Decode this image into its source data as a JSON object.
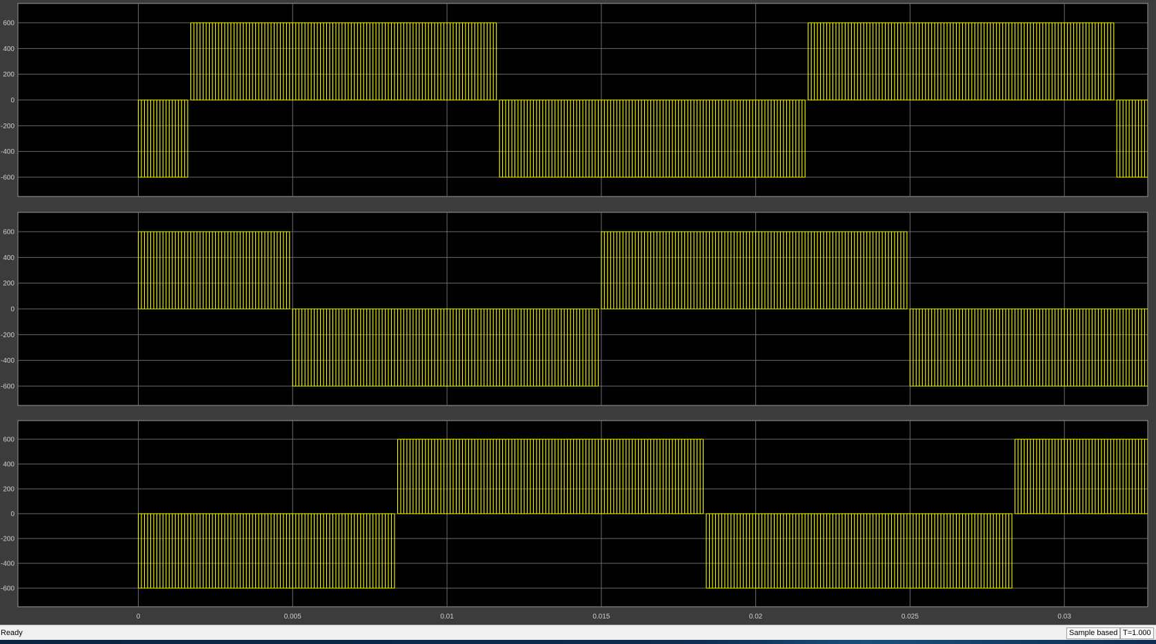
{
  "status_bar": {
    "status": "Ready",
    "sample_mode": "Sample based",
    "time": "T=1.000"
  },
  "colors": {
    "axes_background": "#000000",
    "figure_background": "#3c3c3c",
    "trace": "#ffff00",
    "grid": "#6e6e6e",
    "tick_text": "#cfcfcf"
  },
  "chart_data": [
    {
      "type": "line",
      "title": "",
      "xlabel": "",
      "ylabel": "",
      "xlim": [
        -0.0039,
        0.0327
      ],
      "ylim": [
        -750,
        750
      ],
      "yticks": [
        600,
        400,
        200,
        0,
        -200,
        -400,
        -600
      ],
      "ytick_labels": [
        "600",
        "400",
        "200",
        "0",
        "-200",
        "-400",
        "-600"
      ],
      "xticks": [
        0,
        0.005,
        0.01,
        0.015,
        0.02,
        0.025,
        0.03
      ],
      "xtick_labels": [],
      "grid": true,
      "pwm_period": 0.0001,
      "series": [
        {
          "segments": [
            {
              "x_start": 0.0,
              "x_end": 0.0016,
              "level": -600
            },
            {
              "x_start": 0.0017,
              "x_end": 0.0116,
              "level": 600
            },
            {
              "x_start": 0.0117,
              "x_end": 0.0216,
              "level": -600
            },
            {
              "x_start": 0.0217,
              "x_end": 0.0316,
              "level": 600
            },
            {
              "x_start": 0.0317,
              "x_end": 0.0327,
              "level": -600
            }
          ]
        }
      ]
    },
    {
      "type": "line",
      "title": "",
      "xlabel": "",
      "ylabel": "",
      "xlim": [
        -0.0039,
        0.0327
      ],
      "ylim": [
        -750,
        750
      ],
      "yticks": [
        600,
        400,
        200,
        0,
        -200,
        -400,
        -600
      ],
      "ytick_labels": [
        "600",
        "400",
        "200",
        "0",
        "-200",
        "-400",
        "-600"
      ],
      "xticks": [
        0,
        0.005,
        0.01,
        0.015,
        0.02,
        0.025,
        0.03
      ],
      "xtick_labels": [],
      "grid": true,
      "pwm_period": 0.0001,
      "series": [
        {
          "segments": [
            {
              "x_start": 0.0,
              "x_end": 0.0049,
              "level": 600
            },
            {
              "x_start": 0.005,
              "x_end": 0.0149,
              "level": -600
            },
            {
              "x_start": 0.015,
              "x_end": 0.0249,
              "level": 600
            },
            {
              "x_start": 0.025,
              "x_end": 0.0327,
              "level": -600
            }
          ]
        }
      ]
    },
    {
      "type": "line",
      "title": "",
      "xlabel": "",
      "ylabel": "",
      "xlim": [
        -0.0039,
        0.0327
      ],
      "ylim": [
        -750,
        750
      ],
      "yticks": [
        600,
        400,
        200,
        0,
        -200,
        -400,
        -600
      ],
      "ytick_labels": [
        "600",
        "400",
        "200",
        "0",
        "-200",
        "-400",
        "-600"
      ],
      "xticks": [
        0,
        0.005,
        0.01,
        0.015,
        0.02,
        0.025,
        0.03
      ],
      "xtick_labels": [
        "0",
        "0.005",
        "0.01",
        "0.015",
        "0.02",
        "0.025",
        "0.03"
      ],
      "grid": true,
      "pwm_period": 0.0001,
      "series": [
        {
          "segments": [
            {
              "x_start": 0.0,
              "x_end": 0.0083,
              "level": -600
            },
            {
              "x_start": 0.0084,
              "x_end": 0.0183,
              "level": 600
            },
            {
              "x_start": 0.0184,
              "x_end": 0.0283,
              "level": -600
            },
            {
              "x_start": 0.0284,
              "x_end": 0.0327,
              "level": 600
            }
          ]
        }
      ]
    }
  ]
}
